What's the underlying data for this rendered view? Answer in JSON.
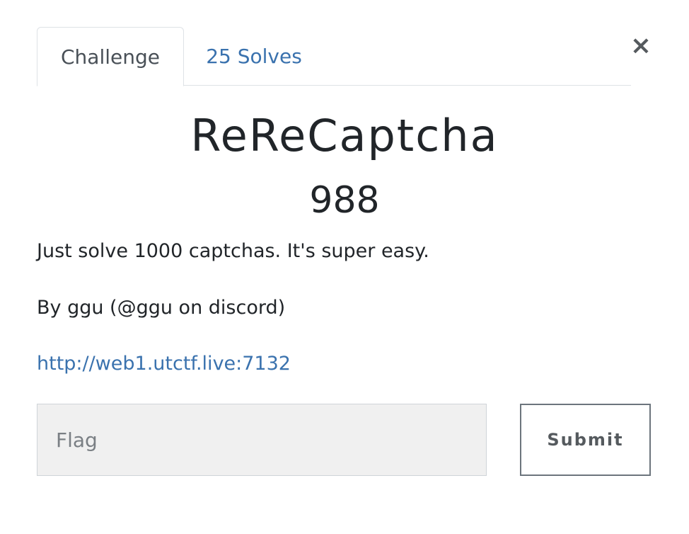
{
  "tabs": [
    {
      "label": "Challenge",
      "active": true
    },
    {
      "label": "25 Solves",
      "active": false
    }
  ],
  "close_icon": "×",
  "challenge": {
    "name": "ReReCaptcha",
    "points": "988",
    "description": [
      "Just solve 1000 captchas. It's super easy.",
      "By ggu (@ggu on discord)"
    ],
    "link": "http://web1.utctf.live:7132"
  },
  "flag_form": {
    "placeholder": "Flag",
    "value": "",
    "submit_label": "Submit"
  },
  "colors": {
    "link": "#3a72ae",
    "text": "#212529",
    "input_bg": "#f0f0f0"
  }
}
